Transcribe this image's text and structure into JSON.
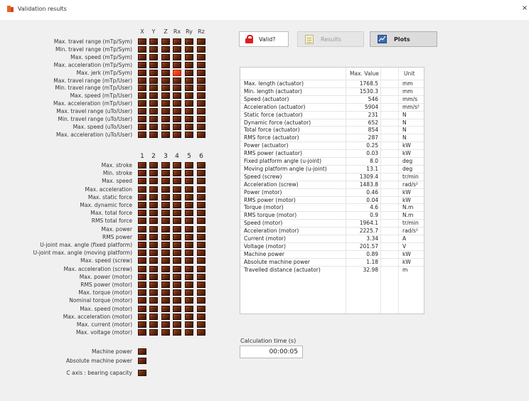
{
  "window": {
    "title": "Validation results",
    "close_glyph": "×"
  },
  "grid1": {
    "axes": [
      "X",
      "Y",
      "Z",
      "Rx",
      "Ry",
      "Rz"
    ],
    "rows": [
      "Max. travel range (mTp/Sym)",
      "Min. travel range (mTp/Sym)",
      "Max. speed (mTp/Sym)",
      "Max. acceleration (mTp/Sym)",
      "Max. jerk (mTp/Sym)",
      "Max. travel range (mTp/User)",
      "Min. travel range (mTp/User)",
      "Max. speed (mTp/User)",
      "Max. acceleration (mTp/User)",
      "Max. travel range (uTo/User)",
      "Min. travel range (uTo/User)",
      "Max. speed (uTo/User)",
      "Max. acceleration (uTo/User)"
    ],
    "red_cells": [
      [
        4,
        3
      ]
    ]
  },
  "grid2": {
    "actuators": [
      "1",
      "2",
      "3",
      "4",
      "5",
      "6"
    ],
    "rows": [
      "Max. stroke",
      "Min. stroke",
      "Max. speed",
      "Max. acceleration",
      "Max. static force",
      "Max. dynamic force",
      "Max. total force",
      "RMS total force",
      "Max. power",
      "RMS power",
      "U-joint max. angle (fixed platform)",
      "U-joint max. angle (moving platform)",
      "Max. speed (screw)",
      "Max. acceleration (screw)",
      "Max. power (motor)",
      "RMS power (motor)",
      "Max. torque (motor)",
      "Nominal torque (motor)",
      "Max. speed (motor)",
      "Max. acceleration (motor)",
      "Max. current (motor)",
      "Max. voltage (motor)"
    ]
  },
  "machine": {
    "rows": [
      "Machine power",
      "Absolute machine power"
    ],
    "c_axis": "C axis : bearing capacity"
  },
  "toolbar": {
    "valid_label": "Valid?",
    "results_label": "Results",
    "plots_label": "Plots"
  },
  "table": {
    "headers": {
      "value": "Max. Value",
      "unit": "Unit"
    },
    "rows": [
      {
        "name": "Max. length (actuator)",
        "value": "1768.5",
        "unit": "mm"
      },
      {
        "name": "Min. length (actuator)",
        "value": "1530.3",
        "unit": "mm"
      },
      {
        "name": "Speed (actuator)",
        "value": "546",
        "unit": "mm/s"
      },
      {
        "name": "Acceleration (actuator)",
        "value": "5904",
        "unit": "mm/s²"
      },
      {
        "name": "Static force (actuator)",
        "value": "231",
        "unit": "N"
      },
      {
        "name": "Dynamic force (actuator)",
        "value": "652",
        "unit": "N"
      },
      {
        "name": "Total force (actuator)",
        "value": "854",
        "unit": "N"
      },
      {
        "name": "RMS force (actuator)",
        "value": "287",
        "unit": "N"
      },
      {
        "name": "Power (actuator)",
        "value": "0.25",
        "unit": "kW"
      },
      {
        "name": "RMS power (actuator)",
        "value": "0.03",
        "unit": "kW"
      },
      {
        "name": "Fixed platform angle (u-joint)",
        "value": "8.0",
        "unit": "deg"
      },
      {
        "name": "Moving platform angle (u-joint)",
        "value": "13.1",
        "unit": "deg"
      },
      {
        "name": "Speed (screw)",
        "value": "1309.4",
        "unit": "tr/min"
      },
      {
        "name": "Acceleration (screw)",
        "value": "1483.8",
        "unit": "rad/s²"
      },
      {
        "name": "Power (motor)",
        "value": "0.46",
        "unit": "kW"
      },
      {
        "name": "RMS power (motor)",
        "value": "0.04",
        "unit": "kW"
      },
      {
        "name": "Torque (motor)",
        "value": "4.6",
        "unit": "N.m"
      },
      {
        "name": "RMS torque (motor)",
        "value": "0.9",
        "unit": "N.m"
      },
      {
        "name": "Speed (motor)",
        "value": "1964.1",
        "unit": "tr/min"
      },
      {
        "name": "Acceleration (motor)",
        "value": "2225.7",
        "unit": "rad/s²"
      },
      {
        "name": "Current (motor)",
        "value": "3.34",
        "unit": "A"
      },
      {
        "name": "Voltage (motor)",
        "value": "201.57",
        "unit": "V"
      },
      {
        "name": "Machine power",
        "value": "0.89",
        "unit": "kW"
      },
      {
        "name": "Absolute machine power",
        "value": "1.18",
        "unit": "kW"
      },
      {
        "name": "Travelled distance (actuator)",
        "value": "32.98",
        "unit": "m"
      }
    ]
  },
  "calc": {
    "label": "Calculation time (s)",
    "value": "00:00:05"
  },
  "colors": {
    "cell_ok": "#6b2a0d",
    "cell_fail": "#f03c1a"
  }
}
